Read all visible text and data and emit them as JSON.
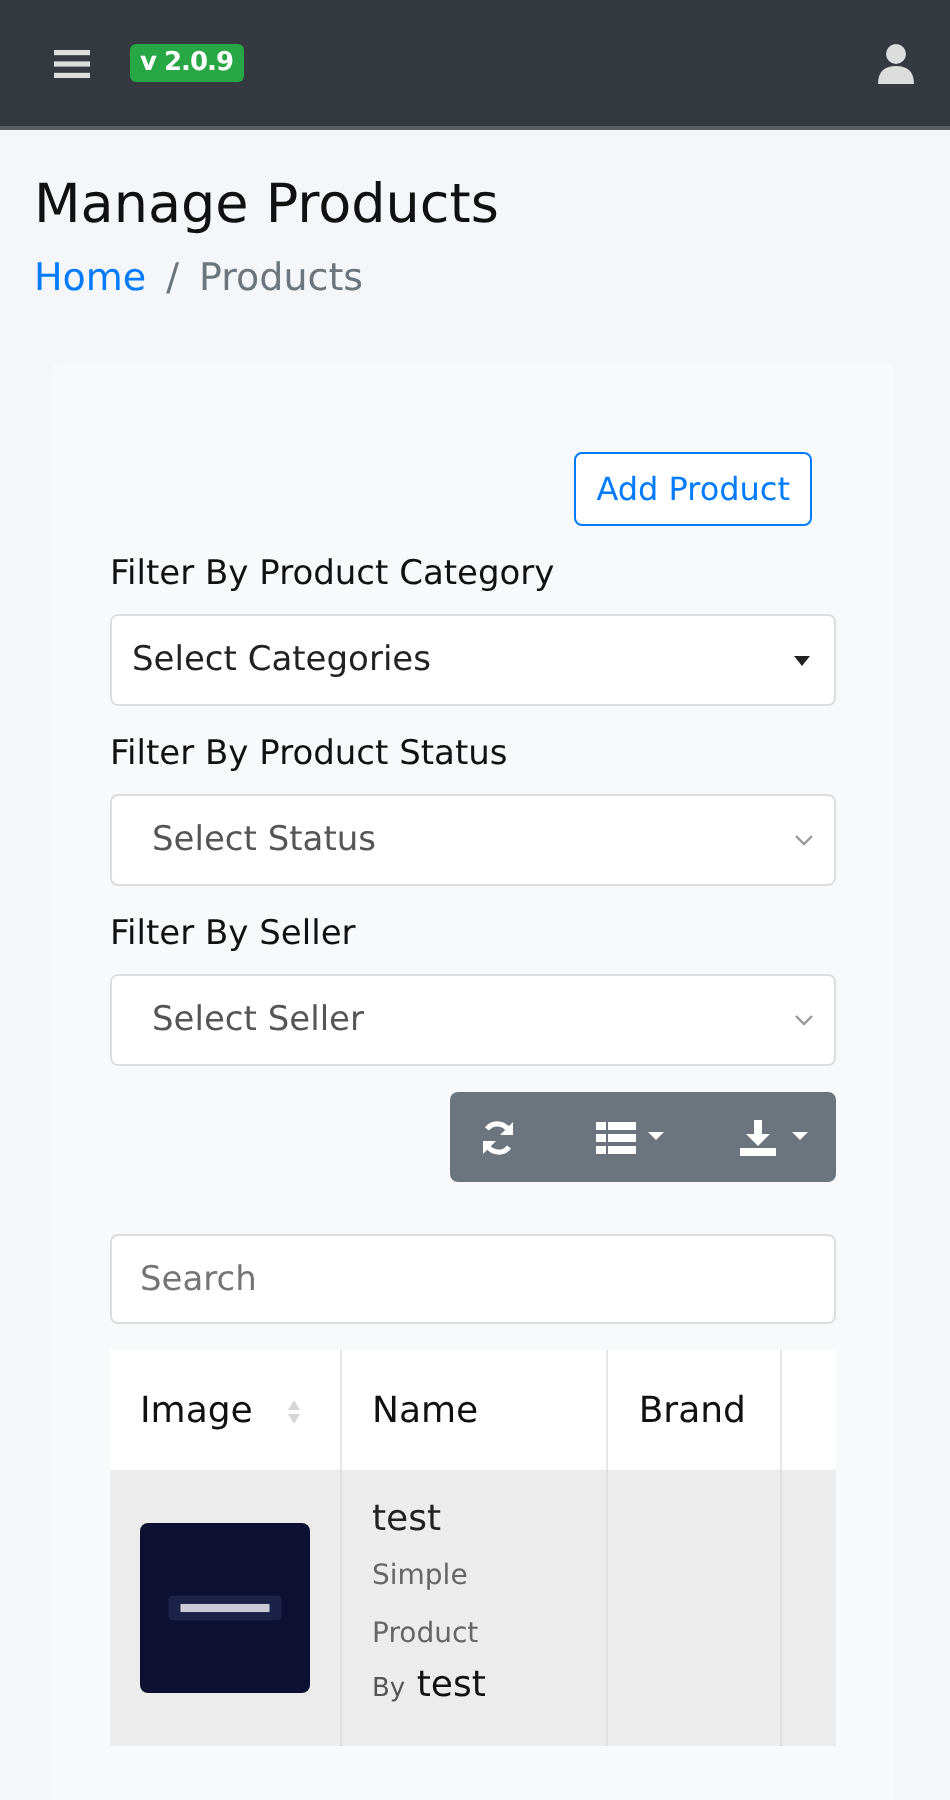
{
  "navbar": {
    "version": "v 2.0.9"
  },
  "page": {
    "title": "Manage Products",
    "breadcrumb_separator": "/",
    "breadcrumb": [
      {
        "label": "Home",
        "kind": "link"
      },
      {
        "label": "Products",
        "kind": "current"
      }
    ]
  },
  "add_button": "Add Product",
  "filters": [
    {
      "label": "Filter By Product Category",
      "placeholder": "Select Categories",
      "kind": "picker"
    },
    {
      "label": "Filter By Product Status",
      "placeholder": "Select Status",
      "kind": "native"
    },
    {
      "label": "Filter By Seller",
      "placeholder": "Select Seller",
      "kind": "native"
    }
  ],
  "search": {
    "placeholder": "Search"
  },
  "table": {
    "columns": [
      {
        "label": "Image",
        "sortable": true
      },
      {
        "label": "Name",
        "sortable": false
      },
      {
        "label": "Brand",
        "sortable": false
      }
    ],
    "rows": [
      {
        "name": "test",
        "type": "Simple Product",
        "by_prefix": "By",
        "seller": "test",
        "brand": ""
      }
    ]
  }
}
